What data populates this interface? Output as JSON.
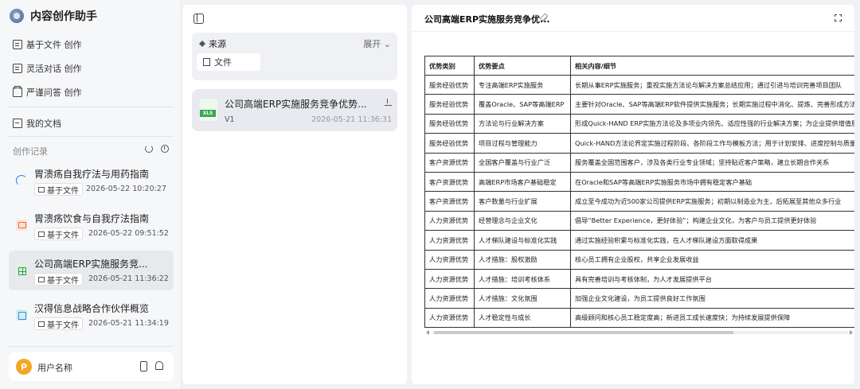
{
  "app": {
    "title": "内容创作助手"
  },
  "menu": {
    "file_create": "基于文件 创作",
    "flex_chat_create": "灵活对话 创作",
    "strict_qa_create": "严谨问答 创作",
    "my_docs": "我的文档"
  },
  "records": {
    "title": "创作记录",
    "items": [
      {
        "title": "胃溃疡自我疗法与用药指南",
        "badge": "基于文件",
        "time": "2026-05-22 10:20:27",
        "icon": "loading-spinner-icon"
      },
      {
        "title": "胃溃疡饮食与自我疗法指南",
        "badge": "基于文件",
        "time": "2026-05-22 09:51:52",
        "icon": "ppt-icon"
      },
      {
        "title": "公司高端ERP实施服务竞...",
        "badge": "基于文件",
        "time": "2026-05-21 11:36:22",
        "icon": "xls-icon"
      },
      {
        "title": "汉得信息战略合作伙伴概览",
        "badge": "基于文件",
        "time": "2026-05-21 11:34:19",
        "icon": "doc-icon"
      }
    ]
  },
  "user": {
    "avatar_letter": "P",
    "name": "用户名称"
  },
  "source": {
    "label": "来源",
    "expand": "展开",
    "file_chip": "文件"
  },
  "doc_card": {
    "thumb_tag": "XLS",
    "title": "公司高端ERP实施服务竞争优势...",
    "version": "V1",
    "time": "2026-05-21 11:36:31"
  },
  "preview": {
    "title": "公司高端ERP实施服务竞争优...",
    "headers": [
      "优势类别",
      "优势要点",
      "相关内容/细节"
    ],
    "rows": [
      [
        "服务经验优势",
        "专注高端ERP实施服务",
        "长期从事ERP实施服务；重视实施方法论与解决方案总结应用；通过引进与培训完善项目团队"
      ],
      [
        "服务经验优势",
        "覆盖Oracle、SAP等高端ERP",
        "主要针对Oracle、SAP等高端ERP软件提供实施服务；长期实施过程中消化、提炼、完善形成方法论"
      ],
      [
        "服务经验优势",
        "方法论与行业解决方案",
        "形成Quick-HAND ERP实施方法论及多项业内领先、适应性强的行业解决方案；为企业提供增值服务"
      ],
      [
        "服务经验优势",
        "项目过程与管理能力",
        "Quick-HAND方法论界定实施过程阶段、各阶段工作与模板方法；用于计划安排、进度控制与质量管理"
      ],
      [
        "客户资源优势",
        "全国客户覆盖与行业广泛",
        "服务覆盖全国范围客户，涉及各类行业专业领域；坚持贴近客户策略，建立长期合作关系"
      ],
      [
        "客户资源优势",
        "高端ERP市场客户基础稳定",
        "在Oracle和SAP等高端ERP实施服务市场中拥有稳定客户基础"
      ],
      [
        "客户资源优势",
        "客户数量与行业扩展",
        "成立至今成功为近500家公司提供ERP实施服务；初期以制造业为主，后拓展至其他众多行业"
      ],
      [
        "人力资源优势",
        "经营理念与企业文化",
        "倡导“Better Experience，更好体验”；构建企业文化，为客户与员工提供更好体验"
      ],
      [
        "人力资源优势",
        "人才梯队建设与标准化实践",
        "通过实施经验积累与标准化实践，在人才梯队建设方面取得成果"
      ],
      [
        "人力资源优势",
        "人才措施：股权激励",
        "核心员工拥有企业股权，共享企业发展收益"
      ],
      [
        "人力资源优势",
        "人才措施：培训考核体系",
        "具有完善培训与考核体制，为人才发展提供平台"
      ],
      [
        "人力资源优势",
        "人才措施：文化氛围",
        "加强企业文化建设，为员工提供良好工作氛围"
      ],
      [
        "人力资源优势",
        "人才稳定性与成长",
        "高级顾问和核心员工稳定度高；新进员工成长速度快；为持续发展提供保障"
      ]
    ]
  }
}
